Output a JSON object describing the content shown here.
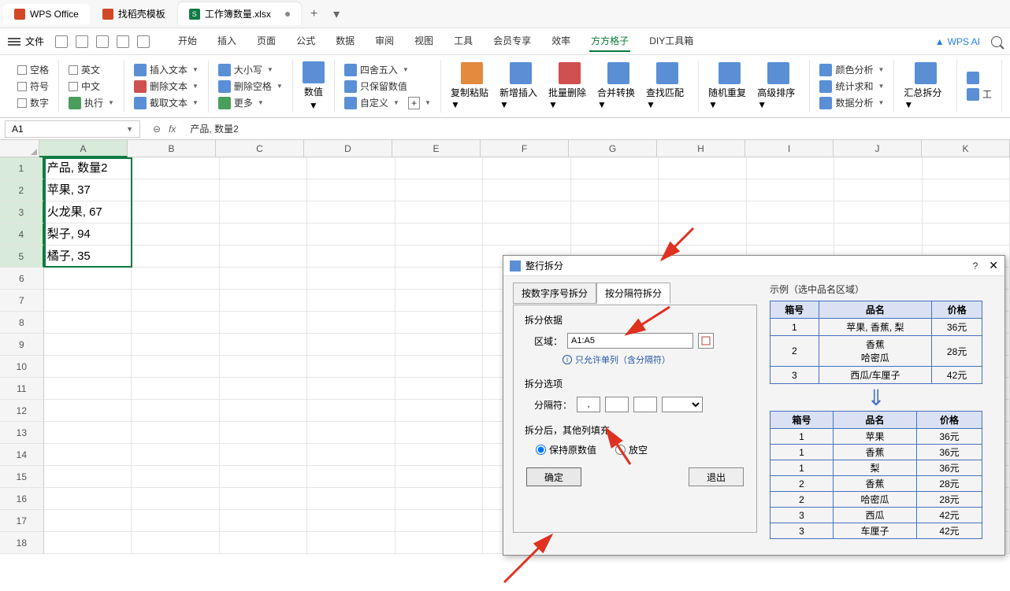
{
  "titlebar": {
    "app_name": "WPS Office",
    "tabs": [
      {
        "label": "找稻壳模板"
      },
      {
        "label": "工作簿数量.xlsx"
      }
    ],
    "new_tab": "+"
  },
  "menu": {
    "file": "文件",
    "items": [
      "开始",
      "插入",
      "页面",
      "公式",
      "数据",
      "审阅",
      "视图",
      "工具",
      "会员专享",
      "效率",
      "方方格子",
      "DIY工具箱"
    ],
    "active": "方方格子",
    "wps_ai": "WPS AI"
  },
  "ribbon": {
    "group1": {
      "blank": "空格",
      "english": "英文",
      "symbol": "符号",
      "chinese": "中文",
      "number": "数字",
      "execute": "执行"
    },
    "group2": {
      "insert_text": "插入文本",
      "delete_text": "删除文本",
      "extract_text": "截取文本"
    },
    "group3": {
      "case": "大小写",
      "delete_blank": "删除空格",
      "more": "更多"
    },
    "group4": {
      "value": "数值",
      "round": "四舍五入",
      "keep_value": "只保留数值",
      "custom": "自定义"
    },
    "group5": {
      "copy_paste": "复制粘贴",
      "new_insert": "新增插入",
      "batch_delete": "批量删除",
      "merge_convert": "合并转换",
      "find_match": "查找匹配"
    },
    "group6": {
      "random": "随机重复",
      "sort": "高级排序"
    },
    "group7": {
      "color_analysis": "颜色分析",
      "stat_sum": "统计求和",
      "data_analysis": "数据分析"
    },
    "group8": {
      "total_split": "汇总拆分",
      "tool": "工"
    }
  },
  "namebox": {
    "ref": "A1"
  },
  "formula": {
    "value": "产品, 数量2"
  },
  "columns": [
    "A",
    "B",
    "C",
    "D",
    "E",
    "F",
    "G",
    "H",
    "I",
    "J",
    "K"
  ],
  "rows": [
    1,
    2,
    3,
    4,
    5,
    6,
    7,
    8,
    9,
    10,
    11,
    12,
    13,
    14,
    15,
    16,
    17,
    18
  ],
  "cells": {
    "A1": "产品, 数量2",
    "A2": "苹果, 37",
    "A3": "火龙果, 67",
    "A4": "梨子, 94",
    "A5": "橘子, 35"
  },
  "selection": {
    "range": "A1:A5"
  },
  "dialog": {
    "title": "整行拆分",
    "help": "?",
    "close": "✕",
    "tabs": {
      "tab1": "按数字序号拆分",
      "tab2": "按分隔符拆分"
    },
    "basis": {
      "title": "拆分依据",
      "range_label": "区域：",
      "range_value": "A1:A5",
      "hint": "只允许单列（含分隔符）"
    },
    "options": {
      "title": "拆分选项",
      "sep_label": "分隔符：",
      "sep_value": ","
    },
    "after": {
      "title": "拆分后，其他列填充",
      "keep": "保持原数值",
      "empty": "放空"
    },
    "buttons": {
      "ok": "确定",
      "exit": "退出"
    },
    "example": {
      "label": "示例（选中品名区域）",
      "before": {
        "headers": [
          "箱号",
          "品名",
          "价格"
        ],
        "rows": [
          [
            "1",
            "苹果, 香蕉, 梨",
            "36元"
          ],
          [
            "2",
            "香蕉\n哈密瓜",
            "28元"
          ],
          [
            "3",
            "西瓜/车厘子",
            "42元"
          ]
        ]
      },
      "after": {
        "headers": [
          "箱号",
          "品名",
          "价格"
        ],
        "rows": [
          [
            "1",
            "苹果",
            "36元"
          ],
          [
            "1",
            "香蕉",
            "36元"
          ],
          [
            "1",
            "梨",
            "36元"
          ],
          [
            "2",
            "香蕉",
            "28元"
          ],
          [
            "2",
            "哈密瓜",
            "28元"
          ],
          [
            "3",
            "西瓜",
            "42元"
          ],
          [
            "3",
            "车厘子",
            "42元"
          ]
        ]
      }
    }
  }
}
